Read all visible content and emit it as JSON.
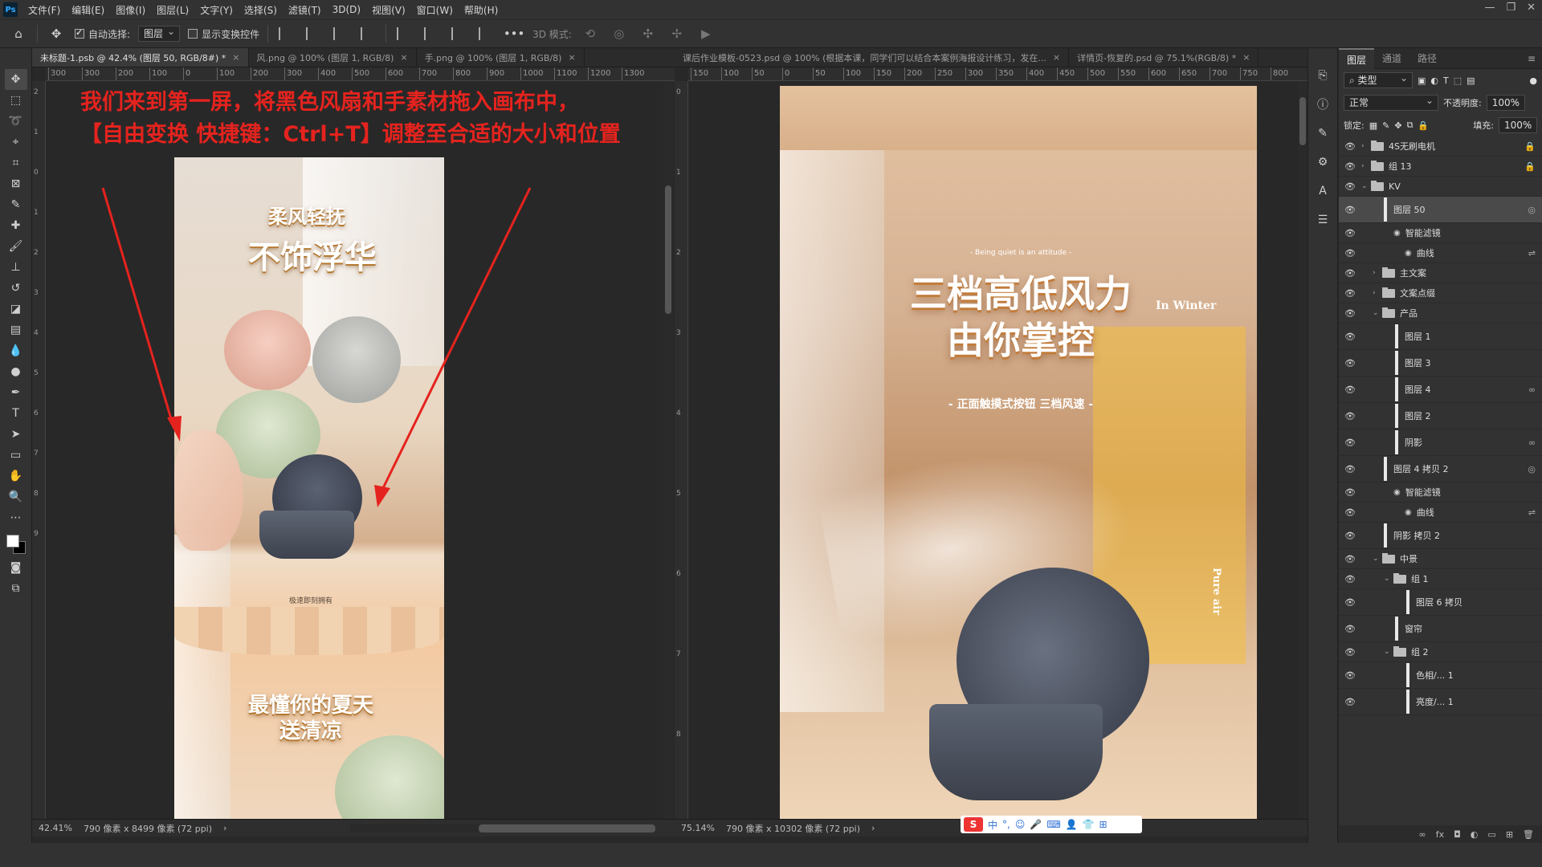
{
  "menubar": {
    "logo": "Ps",
    "items": [
      "文件(F)",
      "编辑(E)",
      "图像(I)",
      "图层(L)",
      "文字(Y)",
      "选择(S)",
      "滤镜(T)",
      "3D(D)",
      "视图(V)",
      "窗口(W)",
      "帮助(H)"
    ]
  },
  "optbar": {
    "auto_select_label": "自动选择:",
    "auto_select_target": "图层",
    "show_transform_label": "显示变换控件",
    "mode_3d_label": "3D 模式:"
  },
  "left_doc": {
    "tabs": [
      {
        "label": "未标题-1.psb @ 42.4% (图层 50, RGB/8#) *",
        "active": true
      },
      {
        "label": "风.png @ 100% (图层 1, RGB/8)",
        "active": false
      },
      {
        "label": "手.png @ 100% (图层 1, RGB/8)",
        "active": false
      }
    ],
    "ruler": [
      "300",
      "300",
      "200",
      "100",
      "0",
      "100",
      "200",
      "300",
      "400",
      "500",
      "600",
      "700",
      "800",
      "900",
      "1000",
      "1100",
      "1200",
      "1300"
    ],
    "zoom": "42.41%",
    "doc_info": "790 像素 x 8499 像素 (72 ppi)"
  },
  "annotation": {
    "line1": "我们来到第一屏，将黑色风扇和手素材拖入画布中，",
    "line2": "【自由变换 快捷键：Ctrl+T】调整至合适的大小和位置"
  },
  "left_poster": {
    "title1": "柔风轻抚",
    "title2": "不饰浮华",
    "badge": "极速即刻拥有",
    "title3": "最懂你的夏天",
    "title4": "送清凉"
  },
  "right_doc": {
    "tabs": [
      {
        "label": "课后作业模板-0523.psd @ 100% (根据本课，同学们可以结合本案例海报设计练习，发在...",
        "active": false
      },
      {
        "label": "详情页-恢复的.psd @ 75.1%(RGB/8) *",
        "active": false
      }
    ],
    "ruler": [
      "150",
      "100",
      "50",
      "0",
      "50",
      "100",
      "150",
      "200",
      "250",
      "300",
      "350",
      "400",
      "450",
      "500",
      "550",
      "600",
      "650",
      "700",
      "750",
      "800"
    ],
    "zoom": "75.14%",
    "doc_info": "790 像素 x 10302 像素 (72 ppi)"
  },
  "right_poster": {
    "kicker": "- Being quiet is an attitude -",
    "title1": "三档高低风力",
    "title2": "由你掌控",
    "subtitle": "- 正面触摸式按钮 三档风速 -",
    "side_en": "In Winter",
    "side_vertical": "Pure air"
  },
  "layers_panel": {
    "tabs": [
      "图层",
      "通道",
      "路径"
    ],
    "filter_kind": "类型",
    "blend_mode": "正常",
    "opacity_label": "不透明度:",
    "opacity_value": "100%",
    "lock_label": "锁定:",
    "fill_label": "填充:",
    "fill_value": "100%",
    "layers": [
      {
        "name": "4S无刷电机",
        "kind": "folder",
        "indent": 0,
        "caret": "›",
        "right": "🔒"
      },
      {
        "name": "组 13",
        "kind": "folder",
        "indent": 0,
        "caret": "›",
        "right": "🔒"
      },
      {
        "name": "KV",
        "kind": "folder",
        "indent": 0,
        "caret": "⌄",
        "right": ""
      },
      {
        "name": "图层 50",
        "kind": "smart",
        "indent": 1,
        "caret": "",
        "right": "◎",
        "selected": true
      },
      {
        "name": "智能滤镜",
        "kind": "filter",
        "indent": 2,
        "caret": "",
        "right": ""
      },
      {
        "name": "曲线",
        "kind": "filter-item",
        "indent": 3,
        "caret": "",
        "right": "⇌"
      },
      {
        "name": "主文案",
        "kind": "folder",
        "indent": 1,
        "caret": "›",
        "right": ""
      },
      {
        "name": "文案点缀",
        "kind": "folder",
        "indent": 1,
        "caret": "›",
        "right": ""
      },
      {
        "name": "产品",
        "kind": "folder",
        "indent": 1,
        "caret": "⌄",
        "right": ""
      },
      {
        "name": "图层 1",
        "kind": "layer",
        "indent": 2,
        "caret": "",
        "right": ""
      },
      {
        "name": "图层 3",
        "kind": "layer",
        "indent": 2,
        "caret": "",
        "right": ""
      },
      {
        "name": "图层 4",
        "kind": "layer",
        "indent": 2,
        "caret": "",
        "right": "∞"
      },
      {
        "name": "图层 2",
        "kind": "layer",
        "indent": 2,
        "caret": "",
        "right": ""
      },
      {
        "name": "阴影",
        "kind": "layer",
        "indent": 2,
        "caret": "",
        "right": "∞"
      },
      {
        "name": "图层 4 拷贝 2",
        "kind": "smart",
        "indent": 1,
        "caret": "",
        "right": "◎"
      },
      {
        "name": "智能滤镜",
        "kind": "filter",
        "indent": 2,
        "caret": "",
        "right": ""
      },
      {
        "name": "曲线",
        "kind": "filter-item",
        "indent": 3,
        "caret": "",
        "right": "⇌"
      },
      {
        "name": "阴影 拷贝 2",
        "kind": "layer",
        "indent": 1,
        "caret": "",
        "right": ""
      },
      {
        "name": "中景",
        "kind": "folder",
        "indent": 1,
        "caret": "⌄",
        "right": ""
      },
      {
        "name": "组 1",
        "kind": "folder",
        "indent": 2,
        "caret": "⌄",
        "right": ""
      },
      {
        "name": "图层 6 拷贝",
        "kind": "layer",
        "indent": 3,
        "caret": "",
        "right": ""
      },
      {
        "name": "窗帘",
        "kind": "layer",
        "indent": 2,
        "caret": "",
        "right": ""
      },
      {
        "name": "组 2",
        "kind": "folder",
        "indent": 2,
        "caret": "⌄",
        "right": ""
      },
      {
        "name": "色相/... 1",
        "kind": "adjust",
        "indent": 3,
        "caret": "",
        "right": ""
      },
      {
        "name": "亮度/... 1",
        "kind": "adjust",
        "indent": 3,
        "caret": "",
        "right": ""
      }
    ]
  },
  "ime": {
    "icons": [
      "中",
      "°,",
      "☺",
      "🎤",
      "⌨",
      "👤",
      "👕",
      "⊞"
    ]
  },
  "colors": {
    "annotation": "#e5231e",
    "panel": "#323232",
    "canvas_bg": "#282828",
    "accent": "#31a8ff"
  }
}
